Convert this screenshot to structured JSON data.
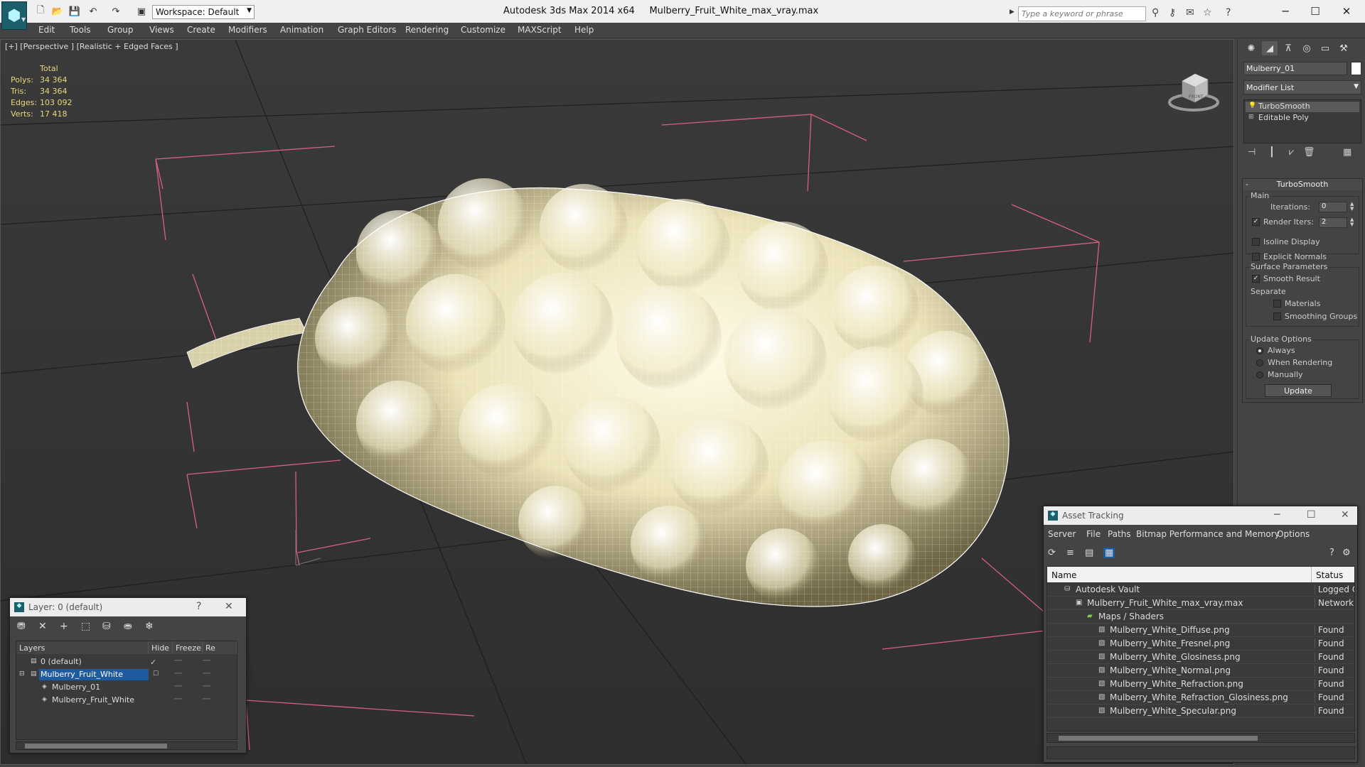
{
  "titlebar": {
    "workspace": "Workspace: Default",
    "app_title": "Autodesk 3ds Max  2014 x64",
    "file_title": "Mulberry_Fruit_White_max_vray.max",
    "search_placeholder": "Type a keyword or phrase"
  },
  "menu": [
    "Edit",
    "Tools",
    "Group",
    "Views",
    "Create",
    "Modifiers",
    "Animation",
    "Graph Editors",
    "Rendering",
    "Customize",
    "MAXScript",
    "Help"
  ],
  "viewport": {
    "label": "[+] [Perspective ] [Realistic + Edged Faces ]",
    "stats_header": "Total",
    "stats": [
      {
        "k": "Polys:",
        "v": "34 364"
      },
      {
        "k": "Tris:",
        "v": "34 364"
      },
      {
        "k": "Edges:",
        "v": "103 092"
      },
      {
        "k": "Verts:",
        "v": "17 418"
      }
    ],
    "viewcube_label": "FRONT"
  },
  "command_panel": {
    "object_name": "Mulberry_01",
    "object_color": "#ffffff",
    "modifier_list": "Modifier List",
    "stack": [
      "TurboSmooth",
      "Editable Poly"
    ],
    "rollout_title": "TurboSmooth",
    "main_label": "Main",
    "iterations_label": "Iterations:",
    "iterations_value": "0",
    "render_iters_label": "Render Iters:",
    "render_iters_value": "2",
    "isoline_label": "Isoline Display",
    "explicit_normals_label": "Explicit Normals",
    "surface_params_label": "Surface Parameters",
    "smooth_result_label": "Smooth Result",
    "separate_label": "Separate",
    "materials_label": "Materials",
    "smoothing_groups_label": "Smoothing Groups",
    "update_options_label": "Update Options",
    "always_label": "Always",
    "when_rendering_label": "When Rendering",
    "manually_label": "Manually",
    "update_button": "Update"
  },
  "layer_window": {
    "title": "Layer: 0 (default)",
    "help": "?",
    "columns": [
      "Layers",
      "Hide",
      "Freeze",
      "Re"
    ],
    "rows": [
      "0 (default)",
      "Mulberry_Fruit_White",
      "Mulberry_01",
      "Mulberry_Fruit_White"
    ]
  },
  "asset_window": {
    "title": "Asset Tracking",
    "menu": [
      "Server",
      "File",
      "Paths",
      "Bitmap Performance and Memory",
      "Options"
    ],
    "columns": [
      "Name",
      "Status"
    ],
    "rows": [
      {
        "name": "Autodesk Vault",
        "status": "Logged Ou"
      },
      {
        "name": "Mulberry_Fruit_White_max_vray.max",
        "status": "Network P"
      },
      {
        "name": "Maps / Shaders",
        "status": ""
      },
      {
        "name": "Mulberry_White_Diffuse.png",
        "status": "Found"
      },
      {
        "name": "Mulberry_White_Fresnel.png",
        "status": "Found"
      },
      {
        "name": "Mulberry_White_Glosiness.png",
        "status": "Found"
      },
      {
        "name": "Mulberry_White_Normal.png",
        "status": "Found"
      },
      {
        "name": "Mulberry_White_Refraction.png",
        "status": "Found"
      },
      {
        "name": "Mulberry_White_Refraction_Glosiness.png",
        "status": "Found"
      },
      {
        "name": "Mulberry_White_Specular.png",
        "status": "Found"
      }
    ]
  }
}
